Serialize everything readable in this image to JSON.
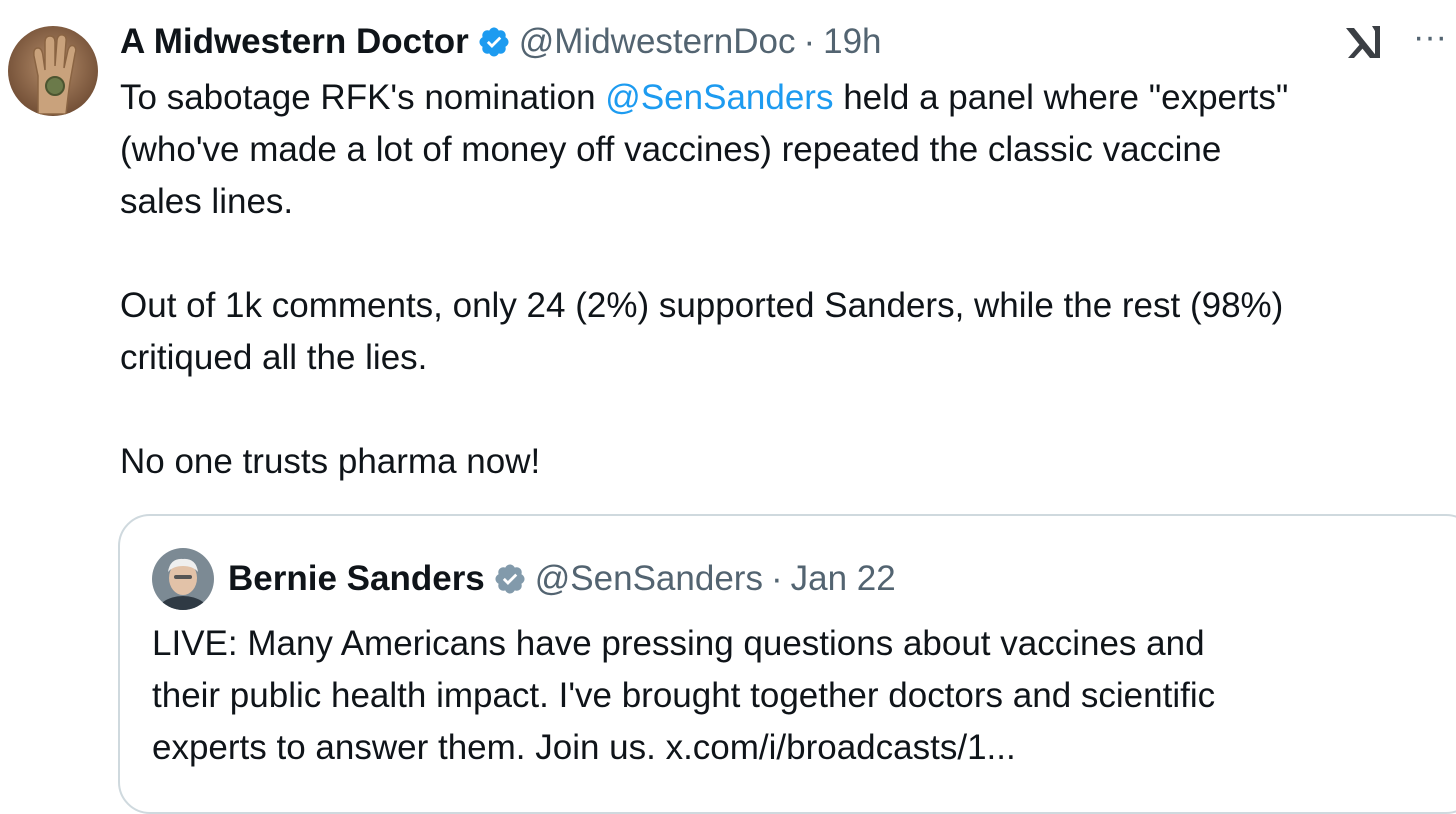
{
  "tweet": {
    "author_name": "A Midwestern Doctor",
    "handle": "@MidwesternDoc",
    "separator": "·",
    "time": "19h",
    "more_label": "···",
    "text_line1_before": "To sabotage RFK's nomination ",
    "text_line1_mention": "@SenSanders",
    "text_line1_after": " held a panel where \"experts\"",
    "text_line2": "(who've made a lot of money off vaccines) repeated the classic vaccine",
    "text_line3": "sales lines.",
    "text_line4": "Out of 1k comments, only 24 (2%) supported Sanders, while the rest (98%)",
    "text_line5": "critiqued all the lies.",
    "text_line6": "No one trusts pharma now!"
  },
  "quote": {
    "author_name": "Bernie Sanders",
    "handle": "@SenSanders",
    "separator": "·",
    "date": "Jan 22",
    "text_line1": "LIVE: Many Americans have pressing questions about vaccines and",
    "text_line2": "their public health impact. I've brought together doctors and scientific",
    "text_line3": "experts to answer them. Join us. x.com/i/broadcasts/1..."
  },
  "colors": {
    "mention": "#1d9bf0",
    "verified_blue": "#1d9bf0",
    "verified_gray": "#829aab",
    "muted_text": "#536471",
    "card_border": "#cfd9de"
  },
  "icons": {
    "author_avatar": "hand-avatar-icon",
    "verified": "verified-badge-icon",
    "brand": "x-logo-icon",
    "more": "more-icon",
    "quote_avatar": "portrait-avatar-icon"
  }
}
